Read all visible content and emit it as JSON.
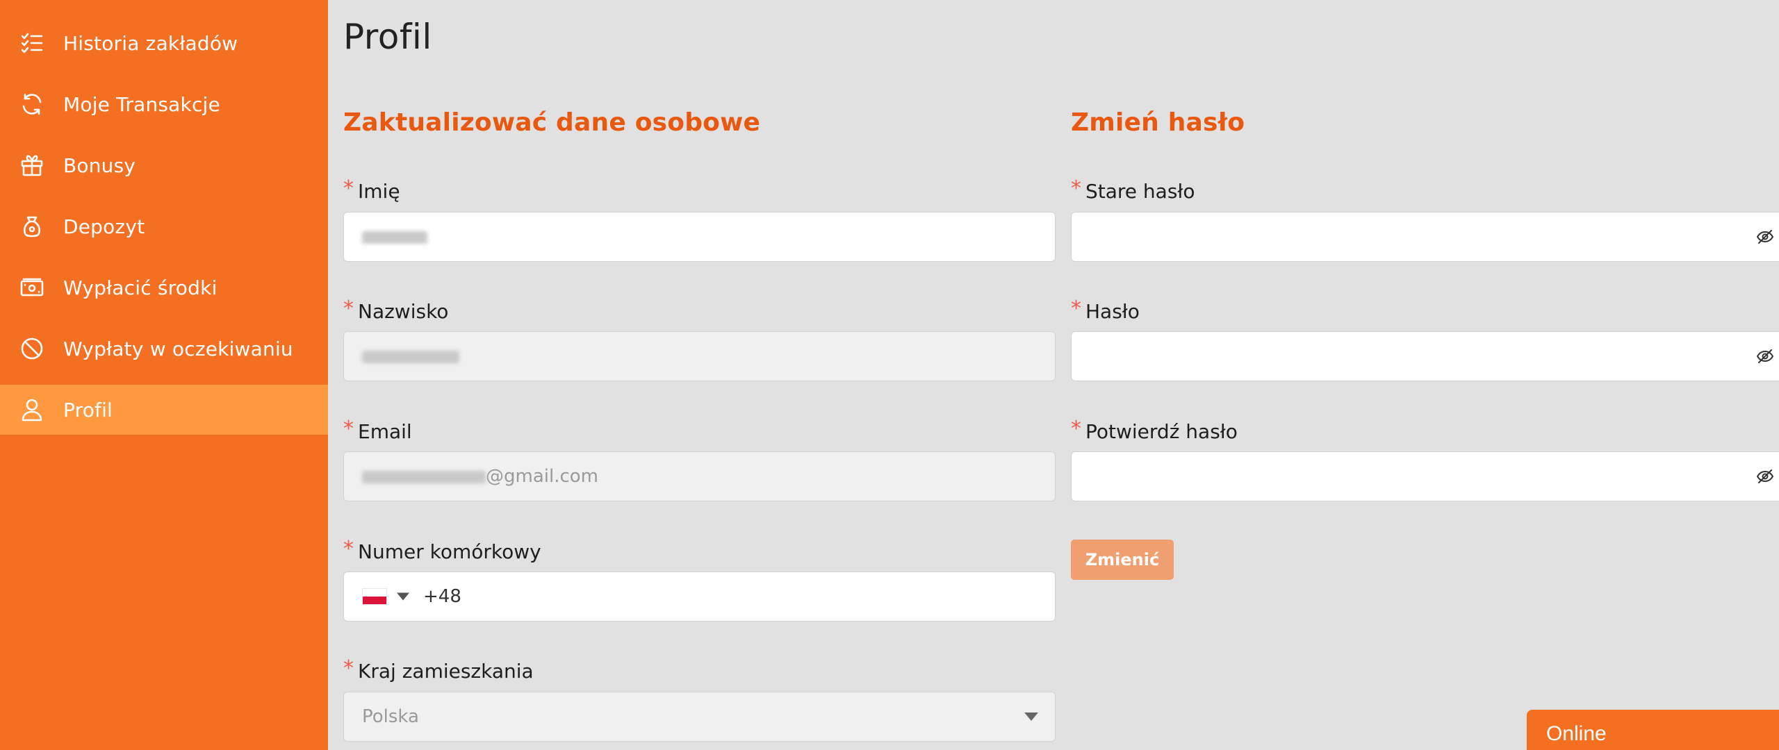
{
  "sidebar": {
    "items": [
      {
        "label": "Historia zakładów",
        "icon": "list-check-icon"
      },
      {
        "label": "Moje Transakcje",
        "icon": "refresh-icon"
      },
      {
        "label": "Bonusy",
        "icon": "gift-icon"
      },
      {
        "label": "Depozyt",
        "icon": "money-bag-icon"
      },
      {
        "label": "Wypłacić środki",
        "icon": "cash-icon"
      },
      {
        "label": "Wypłaty w oczekiwaniu",
        "icon": "ban-icon"
      },
      {
        "label": "Profil",
        "icon": "user-icon",
        "active": true
      }
    ]
  },
  "page": {
    "title": "Profil"
  },
  "personal": {
    "title": "Zaktualizować dane osobowe",
    "first_name": {
      "label": "Imię",
      "required_mark": "*"
    },
    "last_name": {
      "label": "Nazwisko",
      "required_mark": "*"
    },
    "email": {
      "label": "Email",
      "required_mark": "*",
      "value_suffix": "@gmail.com"
    },
    "phone": {
      "label": "Numer komórkowy",
      "required_mark": "*",
      "dial_code": "+48",
      "country_flag": "poland-flag-icon"
    },
    "country": {
      "label": "Kraj zamieszkania",
      "required_mark": "*",
      "value": "Polska"
    }
  },
  "password": {
    "title": "Zmień hasło",
    "old": {
      "label": "Stare hasło",
      "required_mark": "*"
    },
    "new": {
      "label": "Hasło",
      "required_mark": "*"
    },
    "confirm": {
      "label": "Potwierdź hasło",
      "required_mark": "*"
    },
    "submit_label": "Zmienić"
  },
  "chat": {
    "status_label": "Online"
  },
  "colors": {
    "sidebar_bg": "#f36f21",
    "sidebar_active": "#ff9940",
    "accent_title": "#e8580f",
    "page_bg": "#e1e1e1",
    "button_bg": "#f0a070"
  }
}
